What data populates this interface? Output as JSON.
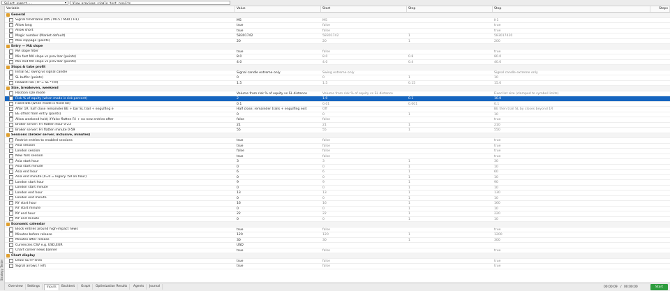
{
  "toolbar": {
    "expert_placeholder": "Select expert...",
    "results_label": "View previous single test results"
  },
  "sidebar_label": "Strategy Tester",
  "columns": [
    "Variable",
    "Value",
    "Start",
    "Step",
    "Stop",
    "Steps"
  ],
  "rows": [
    {
      "type": "section",
      "label": "General"
    },
    {
      "label": "Signal timeframe (M5 / M15 / M30 / H1)",
      "value": "M5",
      "start": "M5",
      "step": "",
      "stop": "H1"
    },
    {
      "label": "Allow long",
      "value": "true",
      "start": "false",
      "step": "",
      "stop": "true"
    },
    {
      "label": "Allow short",
      "value": "true",
      "start": "false",
      "step": "",
      "stop": "true"
    },
    {
      "label": "Magic number (Market default)",
      "value": "58301742",
      "start": "58301742",
      "step": "1",
      "stop": "583017420"
    },
    {
      "label": "Max slippage (points)",
      "value": "20",
      "start": "20",
      "step": "1",
      "stop": "200"
    },
    {
      "type": "section",
      "label": "Entry — MA slope"
    },
    {
      "label": "MA slope filter",
      "value": "true",
      "start": "false",
      "step": "",
      "stop": "true"
    },
    {
      "label": "Min fast MA slope vs prev bar (points)",
      "value": "8.0",
      "start": "8.0",
      "step": "0.8",
      "stop": "80.0"
    },
    {
      "label": "Min mid MA slope vs prev bar (points)",
      "value": "4.0",
      "start": "4.0",
      "step": "0.4",
      "stop": "40.0"
    },
    {
      "type": "section",
      "label": "Stops & take profit"
    },
    {
      "label": "Initial SL: swing vs signal candle",
      "value": "Signal candle extreme only",
      "start": "Swing extreme only",
      "step": "",
      "stop": "Signal candle extreme only"
    },
    {
      "label": "SL buffer (points)",
      "value": "0",
      "start": "0",
      "step": "1",
      "stop": "10"
    },
    {
      "label": "Reward:risk (TP = SL * RR)",
      "value": "1.5",
      "start": "1.5",
      "step": "0.15",
      "stop": "15.0"
    },
    {
      "type": "section",
      "label": "Size, breakeven, weekend"
    },
    {
      "label": "Position size mode",
      "value": "Volume from risk % of equity vs SL distance",
      "start": "Volume from risk % of equity vs SL distance",
      "step": "",
      "stop": "Fixed lot size (clamped to symbol limits)"
    },
    {
      "label": "Risk % of equity (when mode is risk percent)",
      "value": "2",
      "start": "1.0",
      "step": "0.1",
      "stop": "10.0",
      "selected": true
    },
    {
      "label": "Fixed lots (when mode is fixed lot)",
      "value": "0.1",
      "start": "0.01",
      "step": "0.001",
      "stop": "0.1"
    },
    {
      "label": "After 1R: half close remainder BE + bar SL trail + engulfing e",
      "value": "Half close; remainder trails + engulfing exit",
      "start": "Off",
      "step": "",
      "stop": "BE then trail SL by closes beyond 1R"
    },
    {
      "label": "BE offset from entry (points)",
      "value": "0",
      "start": "0",
      "step": "1",
      "stop": "10"
    },
    {
      "label": "Allow weekend hold; if false flatten Fri + no new entries after",
      "value": "false",
      "start": "false",
      "step": "",
      "stop": "true"
    },
    {
      "label": "Broker server: Fri flatten hour 0-23",
      "value": "21",
      "start": "21",
      "step": "1",
      "stop": "210"
    },
    {
      "label": "Broker server: Fri flatten minute 0-59",
      "value": "55",
      "start": "55",
      "step": "1",
      "stop": "550"
    },
    {
      "type": "section",
      "label": "Sessions (broker server, inclusive, minutes)"
    },
    {
      "label": "Restrict entries to enabled sessions",
      "value": "true",
      "start": "false",
      "step": "",
      "stop": "true"
    },
    {
      "label": "Asia session",
      "value": "true",
      "start": "false",
      "step": "",
      "stop": "true"
    },
    {
      "label": "London session",
      "value": "false",
      "start": "false",
      "step": "",
      "stop": "true"
    },
    {
      "label": "New York session",
      "value": "true",
      "start": "false",
      "step": "",
      "stop": "true"
    },
    {
      "label": "Asia start hour",
      "value": "3",
      "start": "3",
      "step": "1",
      "stop": "30"
    },
    {
      "label": "Asia start minute",
      "value": "0",
      "start": "0",
      "step": "1",
      "stop": "10"
    },
    {
      "label": "Asia end hour",
      "value": "6",
      "start": "6",
      "step": "1",
      "stop": "60"
    },
    {
      "label": "Asia end minute (0=0 = legacy :59 on hour)",
      "value": "0",
      "start": "0",
      "step": "1",
      "stop": "10"
    },
    {
      "label": "London start hour",
      "value": "9",
      "start": "9",
      "step": "1",
      "stop": "90"
    },
    {
      "label": "London start minute",
      "value": "0",
      "start": "0",
      "step": "1",
      "stop": "10"
    },
    {
      "label": "London end hour",
      "value": "13",
      "start": "13",
      "step": "1",
      "stop": "130"
    },
    {
      "label": "London end minute",
      "value": "0",
      "start": "0",
      "step": "1",
      "stop": "10"
    },
    {
      "label": "NY start hour",
      "value": "16",
      "start": "16",
      "step": "1",
      "stop": "160"
    },
    {
      "label": "NY start minute",
      "value": "0",
      "start": "0",
      "step": "1",
      "stop": "10"
    },
    {
      "label": "NY end hour",
      "value": "22",
      "start": "22",
      "step": "1",
      "stop": "220"
    },
    {
      "label": "NY end minute",
      "value": "0",
      "start": "0",
      "step": "1",
      "stop": "10"
    },
    {
      "type": "section",
      "label": "Economic calendar"
    },
    {
      "label": "Block entries around high-impact news",
      "value": "true",
      "start": "false",
      "step": "",
      "stop": "true"
    },
    {
      "label": "Minutes before release",
      "value": "120",
      "start": "120",
      "step": "1",
      "stop": "1200"
    },
    {
      "label": "Minutes after release",
      "value": "30",
      "start": "30",
      "step": "1",
      "stop": "300"
    },
    {
      "label": "Currencies CSV e.g. USD,EUR",
      "value": "USD",
      "start": "",
      "step": "",
      "stop": ""
    },
    {
      "label": "Chart corner news banner",
      "value": "true",
      "start": "false",
      "step": "",
      "stop": "true"
    },
    {
      "type": "section",
      "label": "Chart display"
    },
    {
      "label": "Draw SL/TP lines",
      "value": "true",
      "start": "false",
      "step": "",
      "stop": "true"
    },
    {
      "label": "Signal arrows / refs",
      "value": "true",
      "start": "false",
      "step": "",
      "stop": "true"
    }
  ],
  "tabs": [
    "Overview",
    "Settings",
    "Inputs",
    "Backtest",
    "Graph",
    "Optimization Results",
    "Agents",
    "Journal"
  ],
  "active_tab": "Inputs",
  "status": {
    "elapsed": "00:00:09",
    "remaining": "00:00:00",
    "start_label": "Start"
  },
  "colors": {
    "selection": "#1565c0",
    "start_button": "#2e9c3e",
    "section_icon": "#e0a030"
  }
}
